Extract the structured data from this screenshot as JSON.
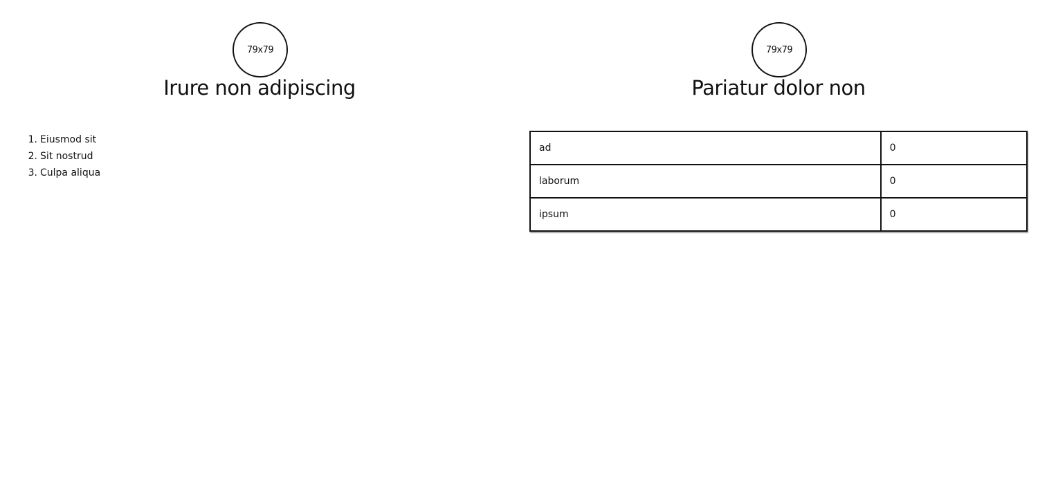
{
  "left": {
    "avatar_text": "79x79",
    "title": "Irure non adipiscing",
    "list": [
      {
        "num": "1.",
        "label": "Eiusmod sit"
      },
      {
        "num": "2.",
        "label": "Sit nostrud"
      },
      {
        "num": "3.",
        "label": "Culpa aliqua"
      }
    ]
  },
  "right": {
    "avatar_text": "79x79",
    "title": "Pariatur dolor non",
    "table": [
      {
        "key": "ad",
        "value": "0"
      },
      {
        "key": "laborum",
        "value": "0"
      },
      {
        "key": "ipsum",
        "value": "0"
      }
    ]
  }
}
